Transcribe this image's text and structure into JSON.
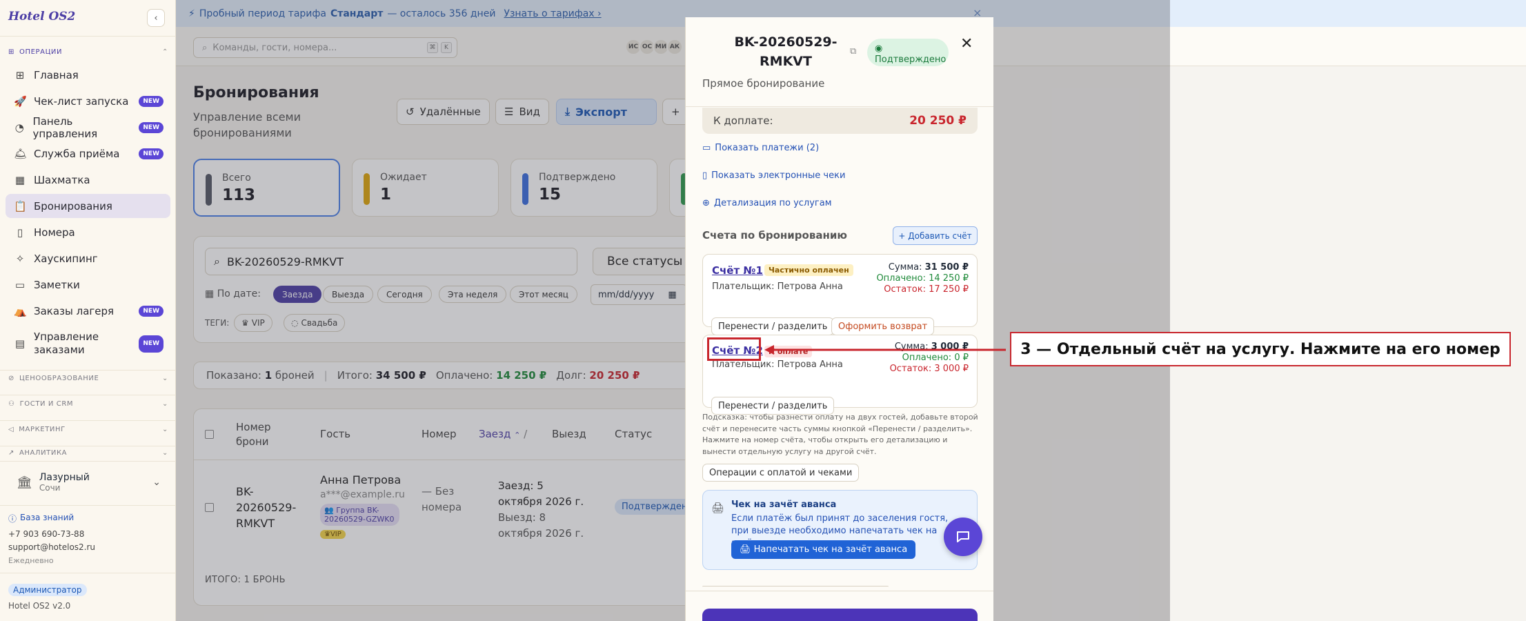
{
  "app": {
    "logo": "Hotel OS2",
    "collapse_icon": "chevron-left-icon"
  },
  "sidebar": {
    "section_operations": "ОПЕРАЦИИ",
    "items": [
      {
        "label": "Главная",
        "icon": "grid-icon",
        "badge": ""
      },
      {
        "label": "Чек-лист запуска",
        "icon": "rocket-icon",
        "badge": "NEW"
      },
      {
        "label": "Панель управления",
        "icon": "gauge-icon",
        "badge": "NEW"
      },
      {
        "label": "Служба приёма",
        "icon": "bell-icon",
        "badge": "NEW"
      },
      {
        "label": "Шахматка",
        "icon": "table-grid-icon",
        "badge": ""
      },
      {
        "label": "Бронирования",
        "icon": "clipboard-icon",
        "badge": "",
        "active": true
      },
      {
        "label": "Номера",
        "icon": "door-icon",
        "badge": ""
      },
      {
        "label": "Хаускипинг",
        "icon": "broom-icon",
        "badge": ""
      },
      {
        "label": "Заметки",
        "icon": "note-icon",
        "badge": ""
      },
      {
        "label": "Заказы лагеря",
        "icon": "tent-icon",
        "badge": "NEW"
      },
      {
        "label": "Управление заказами",
        "icon": "document-icon",
        "badge": "NEW"
      }
    ],
    "sections": [
      {
        "label": "ЦЕНООБРАЗОВАНИЕ",
        "icon": "tag-icon"
      },
      {
        "label": "ГОСТИ И CRM",
        "icon": "users-icon"
      },
      {
        "label": "МАРКЕТИНГ",
        "icon": "megaphone-icon"
      },
      {
        "label": "АНАЛИТИКА",
        "icon": "chart-icon"
      }
    ],
    "hotel": {
      "name": "Лазурный",
      "city": "Сочи"
    },
    "kb_link": "База знаний",
    "phone": "+7 903 690-73-88",
    "email": "support@hotelos2.ru",
    "hours": "Ежедневно",
    "role": "Администратор",
    "version": "Hotel OS2 v2.0"
  },
  "trial": {
    "pre": "Пробный период тарифа",
    "plan": "Стандарт",
    "post": "— осталось 356 дней",
    "link": "Узнать о тарифах ›"
  },
  "topbar": {
    "search_placeholder": "Команды, гости, номера...",
    "kbd1": "⌘",
    "kbd2": "K",
    "avatars": [
      "ИС",
      "ОС",
      "МИ",
      "АК"
    ]
  },
  "page": {
    "title": "Бронирования",
    "subtitle": "Управление всеми бронированиями",
    "btn_deleted": "Удалённые",
    "btn_view": "Вид",
    "btn_export": "Экспорт"
  },
  "stats": [
    {
      "label": "Всего",
      "value": "113",
      "color": "#555a66"
    },
    {
      "label": "Ожидает",
      "value": "1",
      "color": "#e0a60b"
    },
    {
      "label": "Подтверждено",
      "value": "15",
      "color": "#3b6fe0"
    }
  ],
  "filters": {
    "search_value": "BK-20260529-RMKVT",
    "status_select": "Все статусы",
    "by_date": "По дате:",
    "chips": [
      "Заезда",
      "Выезда",
      "Сегодня",
      "Эта неделя",
      "Этот месяц"
    ],
    "date_placeholder": "mm/dd/yyyy",
    "tags_label": "ТЕГИ:",
    "tags": [
      "VIP",
      "Свадьба"
    ]
  },
  "summary": {
    "shown_label": "Показано:",
    "shown_value": "1",
    "shown_unit": "броней",
    "total_label": "Итого:",
    "total_value": "34 500 ₽",
    "paid_label": "Оплачено:",
    "paid_value": "14 250 ₽",
    "debt_label": "Долг:",
    "debt_value": "20 250 ₽"
  },
  "table": {
    "headers": {
      "number": "Номер брони",
      "guest": "Гость",
      "room": "Номер",
      "checkin": "Заезд",
      "checkout": "Выезд",
      "status": "Статус"
    },
    "row": {
      "number": "BK-20260529-RMKVT",
      "guest_name": "Анна Петрова",
      "guest_email": "a***@example.ru",
      "group": "Группа BK-20260529-GZWK0",
      "vip": "VIP",
      "room": "— Без номера",
      "checkin": "Заезд: 5 октября 2026 г.",
      "checkout": "Выезд: 8 октября 2026 г.",
      "status": "Подтверждено"
    },
    "footer": "ИТОГО: 1 БРОНЬ"
  },
  "drawer": {
    "title": "BK-20260529-RMKVT",
    "status": "Подтверждено",
    "subtitle": "Прямое бронирование",
    "due_label": "К доплате:",
    "due_value": "20 250 ₽",
    "link_payments": "Показать платежи (2)",
    "link_receipts": "Показать электронные чеки",
    "link_details": "Детализация по услугам",
    "accounts_title": "Счета по бронированию",
    "add_account": "+ Добавить счёт",
    "accounts": [
      {
        "number": "Счёт №1",
        "status": "Частично оплачен",
        "payer": "Плательщик: Петрова Анна",
        "sum_label": "Сумма:",
        "sum": "31 500 ₽",
        "paid": "Оплачено: 14 250 ₽",
        "rest": "Остаток: 17 250 ₽",
        "btn_split": "Перенести / разделить",
        "btn_refund": "Оформить возврат"
      },
      {
        "number": "Счёт №2",
        "status": "К оплате",
        "payer": "Плательщик: Петрова Анна",
        "sum_label": "Сумма:",
        "sum": "3 000 ₽",
        "paid": "Оплачено: 0 ₽",
        "rest": "Остаток: 3 000 ₽",
        "btn_split": "Перенести / разделить"
      }
    ],
    "hint": "Подсказка: чтобы разнести оплату на двух гостей, добавьте второй счёт и перенесите часть суммы кнопкой «Перенести / разделить». Нажмите на номер счёта, чтобы открыть его детализацию и вынести отдельную услугу на другой счёт.",
    "ops_button": "Операции с оплатой и чеками",
    "advance_title": "Чек на зачёт аванса",
    "advance_text": "Если платёж был принят до заселения гостя, при выезде необходимо напечатать чек на зачёт аванса.",
    "advance_button": "🖨 Напечатать чек на зачёт аванса"
  },
  "annotation": {
    "text": "3 — Отдельный счёт на услугу. Нажмите на его номер",
    "color": "#c8262d"
  }
}
